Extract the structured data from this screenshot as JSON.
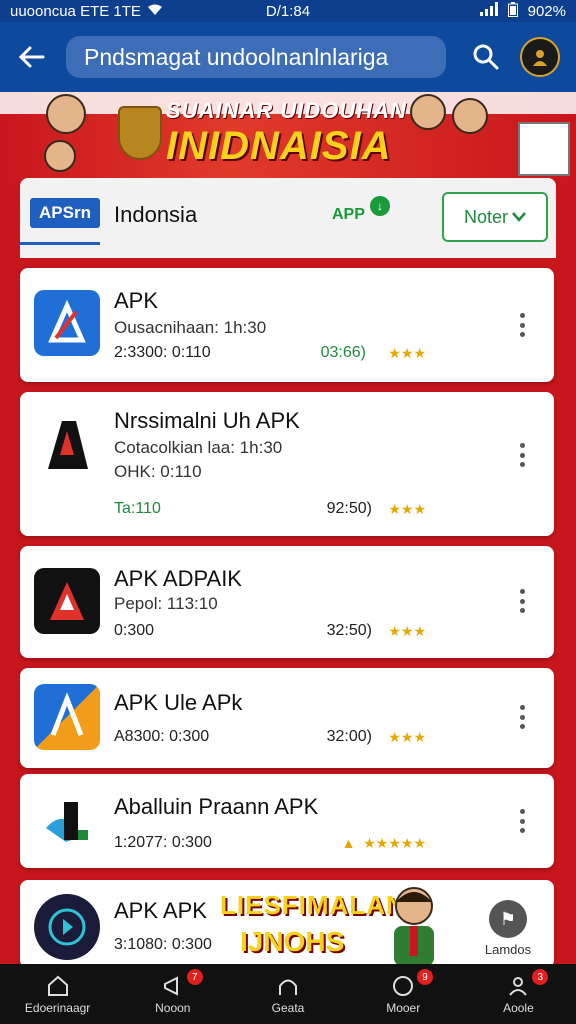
{
  "status_bar": {
    "carrier": "uuooncua ETE 1TE",
    "time": "D/1:84",
    "battery": "902%"
  },
  "header": {
    "search_query": "Pndsmagat undoolnanlnlariga"
  },
  "banner": {
    "title_top": "SUAINAR UIDOUHAN",
    "title_main": "INIDNAISIA"
  },
  "filter_bar": {
    "brand": "APSrn",
    "region": "Indonsia",
    "app_logo": "APP",
    "filter_label": "Noter"
  },
  "apps": [
    {
      "name": "APK",
      "subtitle": "Ousacnihaan: 1h:30",
      "meta": "2:3300: 0:110",
      "rating": "03:66)",
      "rating_color": "green"
    },
    {
      "name": "Nrssimalni Uh APK",
      "subtitle": "Cotacolkian laa: 1h:30",
      "extra": "OHK: 0:110",
      "meta": "Ta:110",
      "meta_color": "green",
      "rating": "92:50)"
    },
    {
      "name": "APK ADPAIK",
      "subtitle": "Pepol: 113:10",
      "meta": "0:300",
      "rating": "32:50)"
    },
    {
      "name": "APK Ule APk",
      "meta": "A8300: 0:300",
      "rating": "32:00)"
    },
    {
      "name": "Aballuin Praann APK",
      "meta": "1:2077: 0:300",
      "rating": ""
    },
    {
      "name": "APK APK",
      "meta": "3:1080: 0:300"
    }
  ],
  "promo": {
    "line1": "LIESFIMALANI",
    "line2": "IJNOHS"
  },
  "lamp_button": {
    "label": "Lamdos"
  },
  "bottom_nav": [
    {
      "label": "Edoerinaagr",
      "badge": ""
    },
    {
      "label": "Nooon",
      "badge": "7"
    },
    {
      "label": "Geata",
      "badge": ""
    },
    {
      "label": "Mooer",
      "badge": "9"
    },
    {
      "label": "Aoole",
      "badge": "3"
    }
  ],
  "colors": {
    "header": "#0d4a9e",
    "accent_red": "#c8161d",
    "green": "#1e8a3e",
    "star": "#e6a800"
  }
}
